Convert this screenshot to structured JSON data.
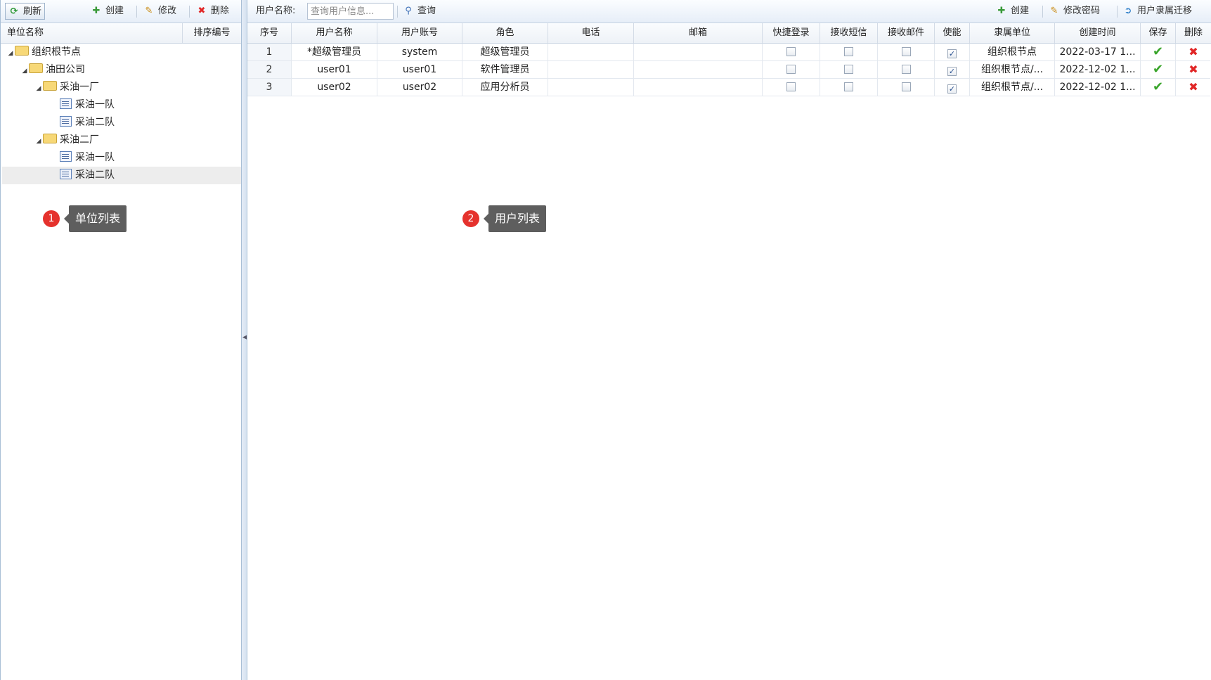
{
  "left": {
    "toolbar": {
      "refresh": "刷新",
      "create": "创建",
      "edit": "修改",
      "delete": "删除"
    },
    "columns": {
      "name": "单位名称",
      "order": "排序编号"
    },
    "tree": [
      {
        "label": "组织根节点",
        "kind": "folder"
      },
      {
        "label": "油田公司",
        "kind": "folder"
      },
      {
        "label": "采油一厂",
        "kind": "folder"
      },
      {
        "label": "采油一队",
        "kind": "leaf"
      },
      {
        "label": "采油二队",
        "kind": "leaf"
      },
      {
        "label": "采油二厂",
        "kind": "folder"
      },
      {
        "label": "采油一队",
        "kind": "leaf"
      },
      {
        "label": "采油二队",
        "kind": "leaf",
        "selected": true
      }
    ],
    "callout": {
      "number": "1",
      "text": "单位列表"
    }
  },
  "right": {
    "toolbar": {
      "search_label": "用户名称:",
      "search_placeholder": "查询用户信息...",
      "search_button": "查询",
      "create": "创建",
      "change_password": "修改密码",
      "migrate": "用户隶属迁移"
    },
    "columns": {
      "seq": "序号",
      "username": "用户名称",
      "account": "用户账号",
      "role": "角色",
      "phone": "电话",
      "email": "邮箱",
      "quick_login": "快捷登录",
      "sms": "接收短信",
      "mail": "接收邮件",
      "enabled": "使能",
      "unit": "隶属单位",
      "created": "创建时间",
      "save": "保存",
      "delete": "删除"
    },
    "rows": [
      {
        "seq": "1",
        "username": "*超级管理员",
        "account": "system",
        "role": "超级管理员",
        "phone": "",
        "email": "",
        "quick_login": false,
        "sms": false,
        "mail": false,
        "enabled": true,
        "unit": "组织根节点",
        "created": "2022-03-17 1..."
      },
      {
        "seq": "2",
        "username": "user01",
        "account": "user01",
        "role": "软件管理员",
        "phone": "",
        "email": "",
        "quick_login": false,
        "sms": false,
        "mail": false,
        "enabled": true,
        "unit": "组织根节点/...",
        "created": "2022-12-02 1..."
      },
      {
        "seq": "3",
        "username": "user02",
        "account": "user02",
        "role": "应用分析员",
        "phone": "",
        "email": "",
        "quick_login": false,
        "sms": false,
        "mail": false,
        "enabled": true,
        "unit": "组织根节点/...",
        "created": "2022-12-02 1..."
      }
    ],
    "callout": {
      "number": "2",
      "text": "用户列表"
    }
  },
  "icons": {
    "refresh": "refresh-icon",
    "create": "plus-icon",
    "edit": "edit-icon",
    "delete": "close-icon",
    "search": "search-icon",
    "change_password": "edit-icon",
    "migrate": "arrow-right-icon",
    "save": "check-icon",
    "row_delete": "close-icon",
    "folder": "folder-icon",
    "leaf": "node-icon"
  },
  "colors": {
    "accent": "#e5322d",
    "save": "#3aa52b",
    "delete": "#e12626",
    "selected_row": "#ededed"
  }
}
